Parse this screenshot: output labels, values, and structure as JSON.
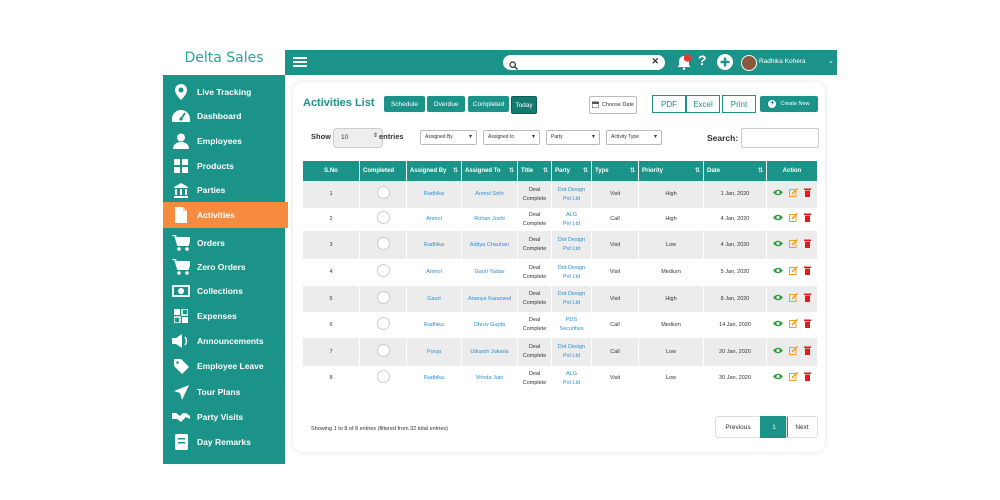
{
  "app": {
    "brand": "Delta Sales"
  },
  "colors": {
    "primary": "#1c9389",
    "active": "#f68b3f",
    "link": "#2b8fd1",
    "delete": "#e01b1b",
    "edit": "#f4a023",
    "view": "#2e9e3e"
  },
  "sidebar": {
    "items": [
      {
        "label": "Live Tracking",
        "icon": "location-pin-icon"
      },
      {
        "label": "Dashboard",
        "icon": "speedometer-icon"
      },
      {
        "label": "Employees",
        "icon": "user-icon"
      },
      {
        "label": "Products",
        "icon": "grid-icon"
      },
      {
        "label": "Parties",
        "icon": "building-icon"
      },
      {
        "label": "Activities",
        "icon": "file-icon",
        "active": true
      },
      {
        "label": "Orders",
        "icon": "cart-icon"
      },
      {
        "label": "Zero Orders",
        "icon": "cart-icon"
      },
      {
        "label": "Collections",
        "icon": "money-icon"
      },
      {
        "label": "Expenses",
        "icon": "expenses-icon"
      },
      {
        "label": "Announcements",
        "icon": "megaphone-icon"
      },
      {
        "label": "Employee Leave",
        "icon": "tag-icon"
      },
      {
        "label": "Tour Plans",
        "icon": "plane-icon"
      },
      {
        "label": "Party Visits",
        "icon": "handshake-icon"
      },
      {
        "label": "Day Remarks",
        "icon": "notebook-icon"
      }
    ]
  },
  "topbar": {
    "search_placeholder": "",
    "notification_count": "1",
    "user_name": "Radhika Kohera"
  },
  "page": {
    "title": "Activities List",
    "filter_buttons": [
      "Schedule",
      "Overdue",
      "Completed",
      "Today"
    ],
    "choose_date": "Choose Date",
    "export_buttons": [
      "PDF",
      "Excel",
      "Print"
    ],
    "create_new": "Create New",
    "show_label": "Show",
    "entries_value": "10",
    "entries_label": "entries",
    "filters": [
      "Assigned By",
      "Assigned to",
      "Party",
      "Activity Type"
    ],
    "search_label": "Search:"
  },
  "table": {
    "headers": [
      "S.No",
      "Completed",
      "Assigned By",
      "Assigned To",
      "Title",
      "Party",
      "Type",
      "Priority",
      "Date",
      "Action"
    ],
    "rows": [
      {
        "sno": "1",
        "by": "Radhika",
        "to": "Anmol Seth",
        "title": [
          "Deal",
          "Complete"
        ],
        "party": [
          "Dot Design",
          "Pvt Ltd"
        ],
        "type": "Visit",
        "priority": "High",
        "date": "1 Jan, 2020"
      },
      {
        "sno": "2",
        "by": "Anmol",
        "to": "Rohan Joshi",
        "title": [
          "Deal",
          "Complete"
        ],
        "party": [
          "ALG",
          "Pvt Ltd"
        ],
        "type": "Call",
        "priority": "High",
        "date": "4 Jan, 2020"
      },
      {
        "sno": "3",
        "by": "Radhika",
        "to": "Aditya Chauhan",
        "title": [
          "Deal",
          "Complete"
        ],
        "party": [
          "Dot Design",
          "Pvt Ltd"
        ],
        "type": "Visit",
        "priority": "Low",
        "date": "4 Jan, 2020"
      },
      {
        "sno": "4",
        "by": "Anmol",
        "to": "Gauri Yadav",
        "title": [
          "Deal",
          "Complete"
        ],
        "party": [
          "Dot Design",
          "Pvt Ltd"
        ],
        "type": "Visit",
        "priority": "Medium",
        "date": "5 Jan, 2020"
      },
      {
        "sno": "5",
        "by": "Gauri",
        "to": "Ananya Karanwal",
        "title": [
          "Deal",
          "Complete"
        ],
        "party": [
          "Dot Design",
          "Pvt Ltd"
        ],
        "type": "Visit",
        "priority": "High",
        "date": "8 Jan, 2020"
      },
      {
        "sno": "6",
        "by": "Radhika",
        "to": "Dhruv Gupta",
        "title": [
          "Deal",
          "Complete"
        ],
        "party": [
          "PDS",
          "Securities"
        ],
        "type": "Call",
        "priority": "Medium",
        "date": "14 Jan, 2020"
      },
      {
        "sno": "7",
        "by": "Pooja",
        "to": "Utkarsh Jukaria",
        "title": [
          "Deal",
          "Complete"
        ],
        "party": [
          "Dot Design",
          "Pvt Ltd"
        ],
        "type": "Call",
        "priority": "Low",
        "date": "20 Jan, 2020"
      },
      {
        "sno": "8",
        "by": "Radhika",
        "to": "Vrinda Jain",
        "title": [
          "Deal",
          "Complete"
        ],
        "party": [
          "ALG",
          "Pvt Ltd"
        ],
        "type": "Visit",
        "priority": "Low",
        "date": "30 Jan, 2020"
      }
    ]
  },
  "footer": {
    "info": "Showing 1 to 8 of 8 entries (filtered from 32 total entries)",
    "previous": "Previous",
    "current_page": "1",
    "next": "Next"
  }
}
